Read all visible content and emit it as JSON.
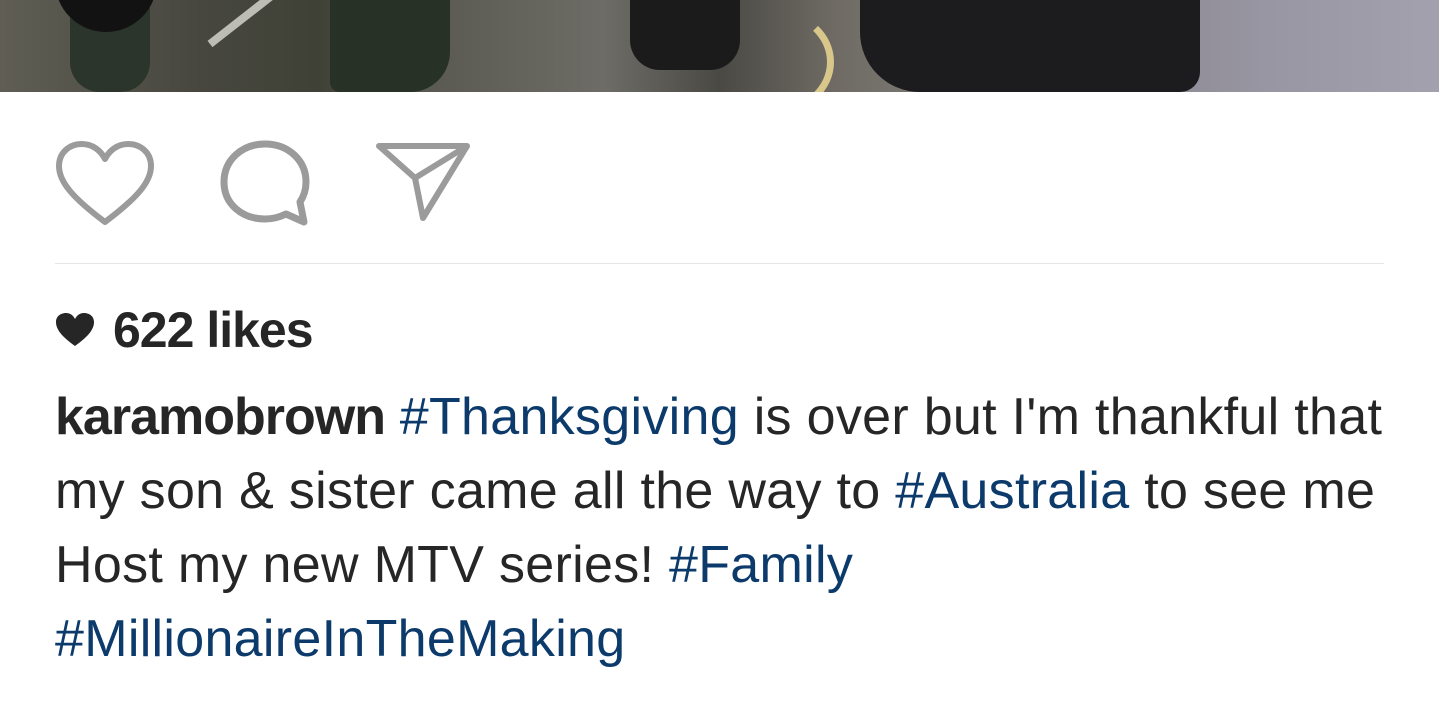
{
  "post": {
    "likes_text": "622 likes",
    "username": "karamobrown",
    "caption_segments": [
      {
        "type": "tag",
        "text": "#Thanksgiving"
      },
      {
        "type": "text",
        "text": " is over but I'm thankful that my son & sister came all the way to "
      },
      {
        "type": "tag",
        "text": "#Australia"
      },
      {
        "type": "text",
        "text": " to see me Host my new MTV series! "
      },
      {
        "type": "tag",
        "text": "#Family"
      },
      {
        "type": "text",
        "text": " "
      },
      {
        "type": "tag",
        "text": "#MillionaireInTheMaking"
      }
    ]
  },
  "icons": {
    "like": "heart-outline-icon",
    "comment": "comment-bubble-icon",
    "share": "send-paper-plane-icon",
    "likes_indicator": "heart-filled-icon"
  },
  "colors": {
    "hashtag": "#0b3a6b",
    "text": "#262626",
    "icon": "#9b9b9b"
  }
}
